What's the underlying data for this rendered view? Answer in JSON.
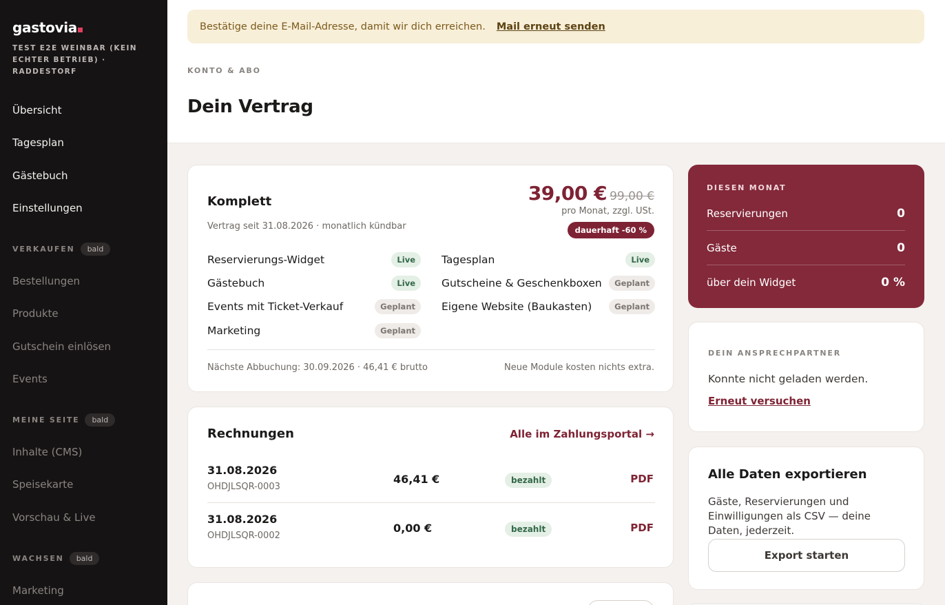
{
  "sidebar": {
    "brand": "gastovia",
    "venue": "TEST E2E WEINBAR (KEIN ECHTER BETRIEB) · RADDESTORF",
    "main_items": [
      "Übersicht",
      "Tagesplan",
      "Gästebuch",
      "Einstellungen"
    ],
    "soon_label": "bald",
    "sell": {
      "title": "VERKAUFEN",
      "items": [
        "Bestellungen",
        "Produkte",
        "Gutschein einlösen",
        "Events"
      ]
    },
    "page": {
      "title": "MEINE SEITE",
      "items": [
        "Inhalte (CMS)",
        "Speisekarte",
        "Vorschau & Live"
      ]
    },
    "grow": {
      "title": "WACHSEN",
      "items": [
        "Marketing"
      ]
    }
  },
  "banner": {
    "text": "Bestätige deine E-Mail-Adresse, damit wir dich erreichen.",
    "link": "Mail erneut senden"
  },
  "header": {
    "breadcrumb": "KONTO & ABO",
    "title": "Dein Vertrag"
  },
  "contract": {
    "plan": "Komplett",
    "since": "Vertrag seit 31.08.2026 · monatlich kündbar",
    "price": "39,00 €",
    "old_price": "99,00 €",
    "price_note": "pro Monat, zzgl. USt.",
    "discount": "dauerhaft -60 %",
    "features": [
      {
        "name": "Reservierungs-Widget",
        "status": "Live"
      },
      {
        "name": "Tagesplan",
        "status": "Live"
      },
      {
        "name": "Gästebuch",
        "status": "Live"
      },
      {
        "name": "Gutscheine & Geschenkboxen",
        "status": "Geplant"
      },
      {
        "name": "Events mit Ticket-Verkauf",
        "status": "Geplant"
      },
      {
        "name": "Eigene Website (Baukasten)",
        "status": "Geplant"
      },
      {
        "name": "Marketing",
        "status": "Geplant"
      }
    ],
    "next_charge": "Nächste Abbuchung: 30.09.2026 · 46,41 € brutto",
    "no_extra": "Neue Module kosten nichts extra."
  },
  "invoices": {
    "title": "Rechnungen",
    "portal_link": "Alle im Zahlungsportal →",
    "rows": [
      {
        "date": "31.08.2026",
        "number": "OHDJLSQR-0003",
        "amount": "46,41 €",
        "status": "bezahlt",
        "pdf": "PDF"
      },
      {
        "date": "31.08.2026",
        "number": "OHDJLSQR-0002",
        "amount": "0,00 €",
        "status": "bezahlt",
        "pdf": "PDF"
      }
    ]
  },
  "month": {
    "label": "DIESEN MONAT",
    "stats": [
      {
        "label": "Reservierungen",
        "value": "0"
      },
      {
        "label": "Gäste",
        "value": "0"
      },
      {
        "label": "über dein Widget",
        "value": "0 %"
      }
    ]
  },
  "contact": {
    "label": "DEIN ANSPRECHPARTNER",
    "message": "Konnte nicht geladen werden.",
    "retry": "Erneut versuchen"
  },
  "export": {
    "title": "Alle Daten exportieren",
    "description": "Gäste, Reservierungen und Einwilligungen als CSV — deine Daten, jederzeit.",
    "button": "Export starten"
  },
  "colors": {
    "accent": "#7e2334",
    "sidebar_bg": "#151314",
    "banner_bg": "#f8efd9",
    "live_badge": "#e4efe5",
    "planned_badge": "#efebe8"
  }
}
